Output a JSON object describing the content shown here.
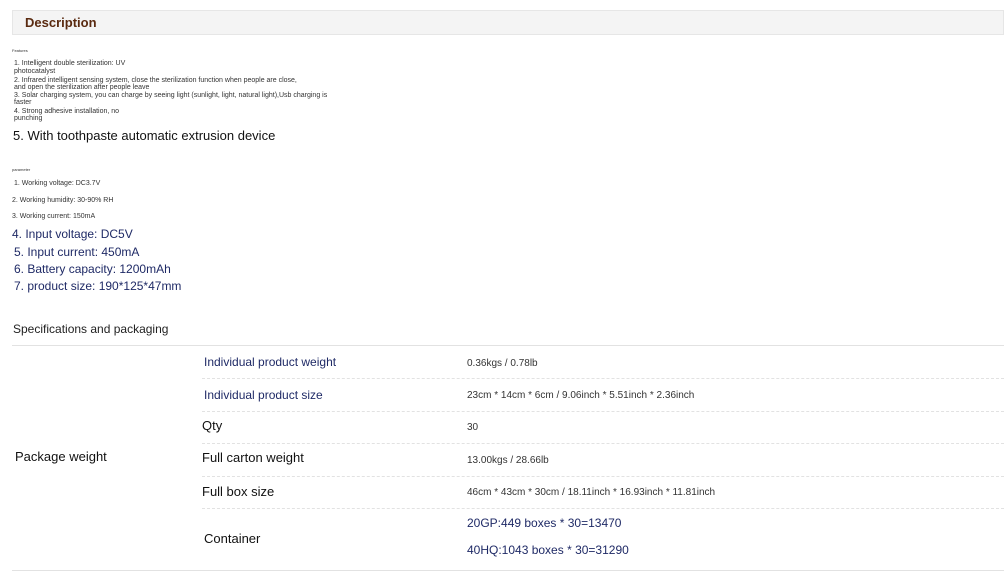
{
  "description": {
    "title": "Description"
  },
  "features": {
    "heading": "Features",
    "items": [
      "1. Intelligent double sterilization: UV",
      "photocatalyst",
      "2. Infrared intelligent sensing system, close the sterilization function when people are close,",
      "and open the sterilization after people leave",
      "3. Solar charging system, you can charge by seeing light (sunlight, light, natural light),Usb charging is",
      "faster",
      "4. Strong adhesive installation, no",
      "punching"
    ],
    "item5": "5. With toothpaste automatic extrusion device"
  },
  "parameter": {
    "heading": "parameter",
    "small_items": [
      "1. Working voltage: DC3.7V",
      "2. Working humidity: 30-90% RH",
      "3. Working current: 150mA"
    ],
    "big_items": [
      "4. Input voltage: DC5V",
      "5. Input current: 450mA",
      "6. Battery capacity: 1200mAh",
      "7. product size: 190*125*47mm"
    ]
  },
  "specs": {
    "heading": "Specifications and packaging",
    "group_label": "Package weight",
    "rows": [
      {
        "label": "Individual product weight",
        "value": "0.36kgs / 0.78lb"
      },
      {
        "label": "Individual product size",
        "value": "23cm * 14cm * 6cm / 9.06inch * 5.51inch * 2.36inch"
      },
      {
        "label": "Qty",
        "value": "30"
      },
      {
        "label": "Full carton weight",
        "value": "13.00kgs / 28.66lb"
      },
      {
        "label": "Full box size",
        "value": "46cm * 43cm * 30cm / 18.11inch * 16.93inch * 11.81inch"
      }
    ],
    "container": {
      "label": "Container",
      "values": [
        "20GP:449 boxes * 30=13470",
        "40HQ:1043 boxes * 30=31290"
      ]
    }
  }
}
